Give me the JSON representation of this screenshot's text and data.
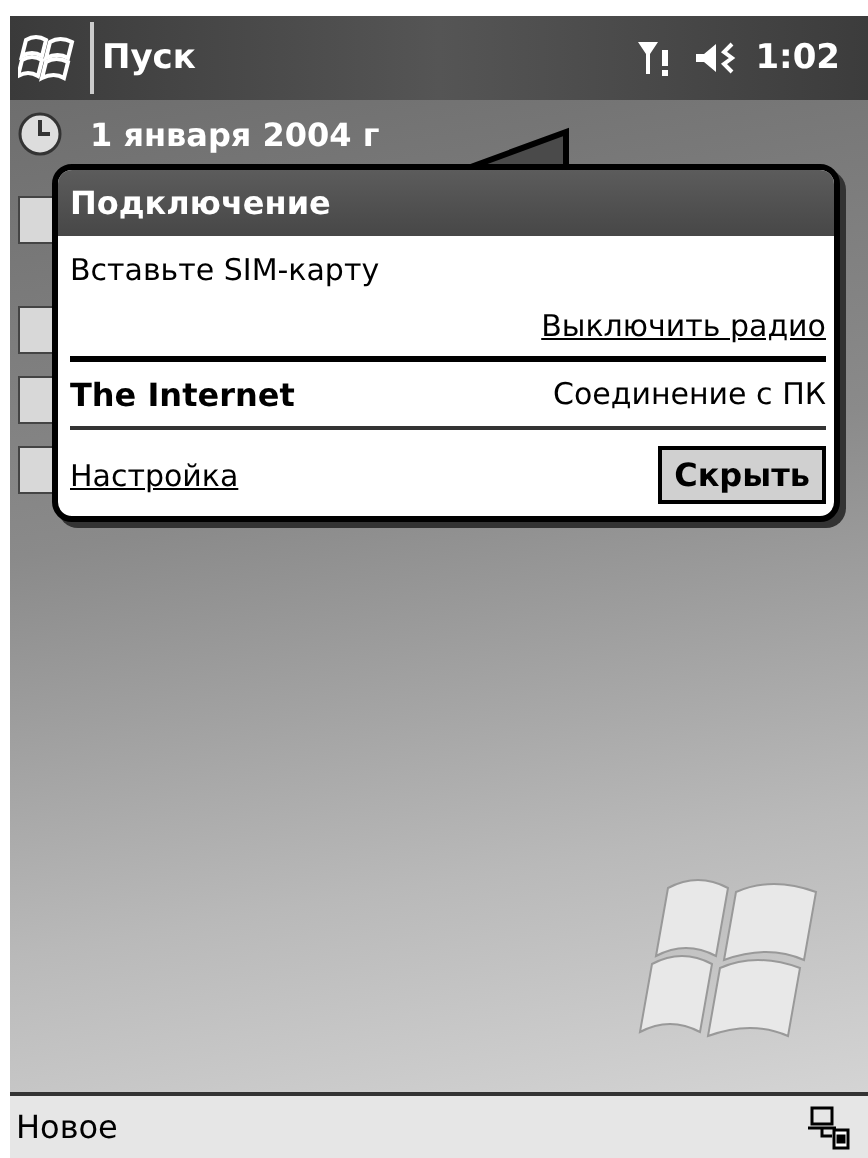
{
  "taskbar": {
    "start_label": "Пуск",
    "time": "1:02"
  },
  "today": {
    "date": "1 января 2004 г"
  },
  "popup": {
    "title": "Подключение",
    "status": "Вставьте SIM-карту",
    "radio_link": "Выключить радио",
    "connection_name": "The Internet",
    "connection_status": "Соединение с ПК",
    "settings_link": "Настройка",
    "hide_button": "Скрыть"
  },
  "menu_bar": {
    "left": "Новое"
  }
}
